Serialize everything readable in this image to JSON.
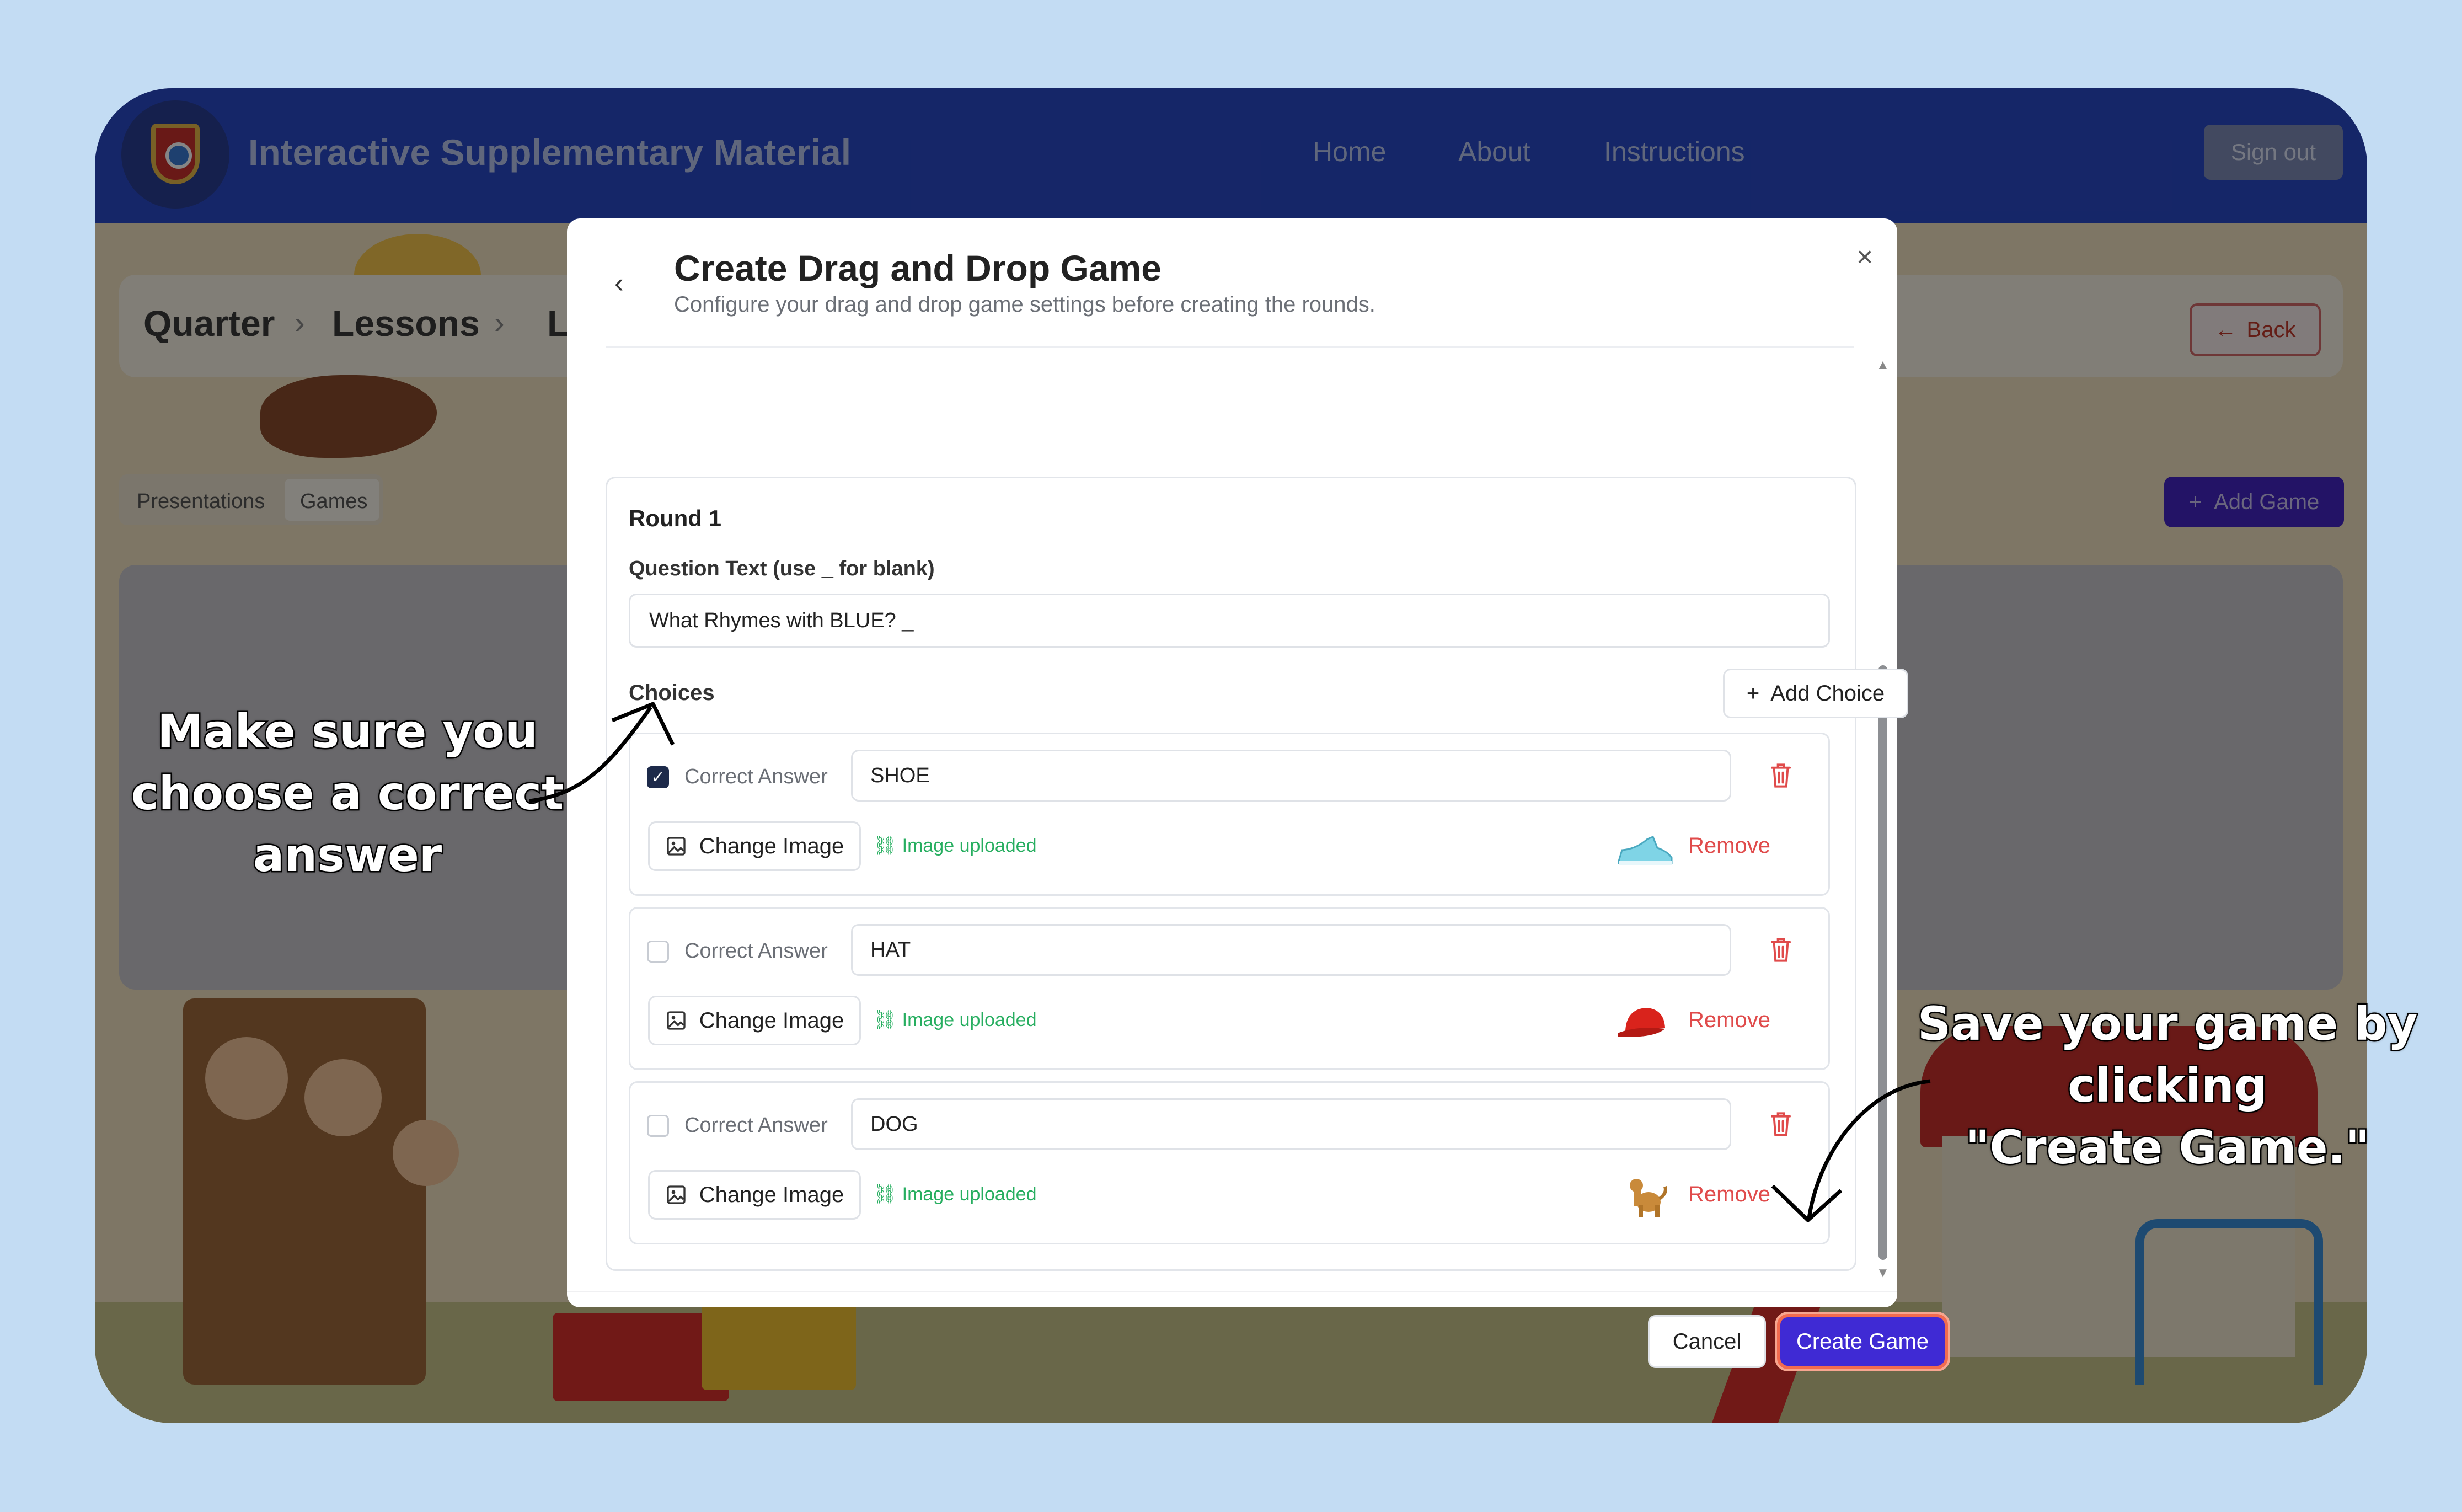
{
  "app": {
    "brand": "Interactive Supplementary Material",
    "nav": [
      "Home",
      "About",
      "Instructions"
    ],
    "sign_out": "Sign out"
  },
  "background": {
    "breadcrumb": [
      "Quarter",
      "Lessons",
      "L"
    ],
    "back": "Back",
    "tabs": [
      "Presentations",
      "Games"
    ],
    "add_game": "Add Game"
  },
  "modal": {
    "title": "Create Drag and Drop Game",
    "subtitle": "Configure your drag and drop game settings before creating the rounds.",
    "round": {
      "title": "Round 1",
      "question_label": "Question Text (use _ for blank)",
      "question_value": "What Rhymes with BLUE? _",
      "choices_label": "Choices",
      "add_choice": "Add Choice",
      "choices": [
        {
          "correct": true,
          "correct_label": "Correct Answer",
          "value": "SHOE",
          "change_image": "Change Image",
          "status": "Image uploaded",
          "remove": "Remove",
          "image_icon": "shoe-image"
        },
        {
          "correct": false,
          "correct_label": "Correct Answer",
          "value": "HAT",
          "change_image": "Change Image",
          "status": "Image uploaded",
          "remove": "Remove",
          "image_icon": "hat-image"
        },
        {
          "correct": false,
          "correct_label": "Correct Answer",
          "value": "DOG",
          "change_image": "Change Image",
          "status": "Image uploaded",
          "remove": "Remove",
          "image_icon": "dog-image"
        }
      ]
    },
    "cancel": "Cancel",
    "create": "Create Game"
  },
  "callouts": {
    "left": [
      "Make sure you",
      "choose a correct",
      "answer"
    ],
    "right": [
      "Save your game by",
      "clicking",
      "\"Create Game.\""
    ]
  },
  "colors": {
    "navbar": "#2a49c7",
    "primary": "#3f2ad4",
    "highlight": "#f26b4f",
    "success": "#27ae60",
    "danger": "#e04b4b",
    "page_bg": "#c3dcf3"
  }
}
